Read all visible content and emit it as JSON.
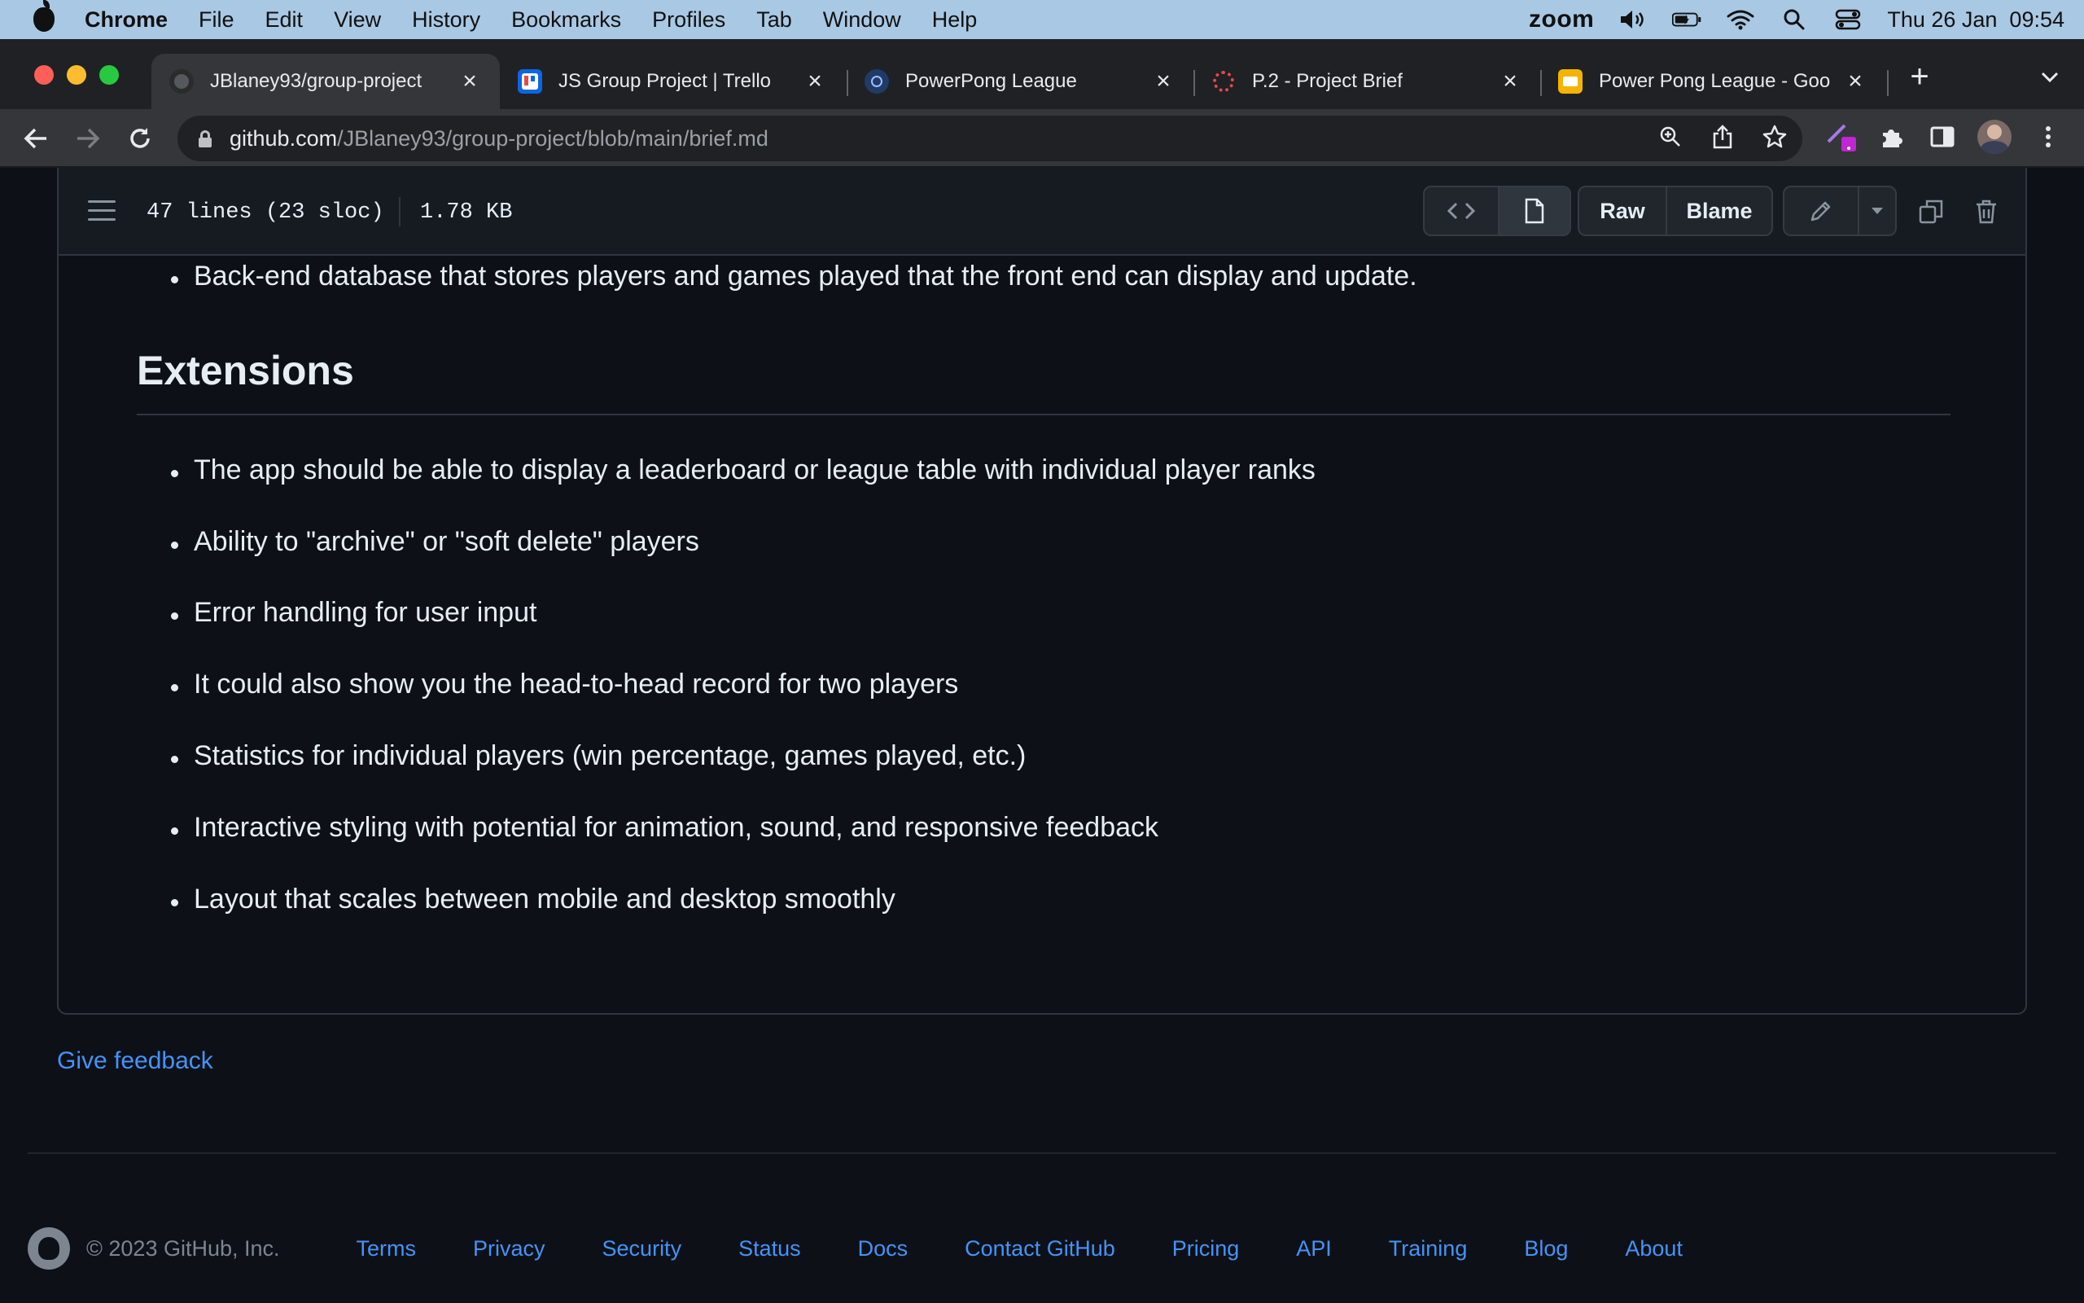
{
  "menubar": {
    "app": "Chrome",
    "items": [
      "File",
      "Edit",
      "View",
      "History",
      "Bookmarks",
      "Profiles",
      "Tab",
      "Window",
      "Help"
    ],
    "zoom_label": "zoom",
    "clock": "Thu 26 Jan  09:54"
  },
  "tabs": [
    {
      "title": "JBlaney93/group-project",
      "favicon": "github-icon",
      "active": true
    },
    {
      "title": "JS Group Project | Trello",
      "favicon": "trello-icon",
      "active": false
    },
    {
      "title": "PowerPong League",
      "favicon": "app-icon",
      "active": false
    },
    {
      "title": "P.2 - Project Brief",
      "favicon": "codeclan-icon",
      "active": false
    },
    {
      "title": "Power Pong League - Goo",
      "favicon": "slides-icon",
      "active": false
    }
  ],
  "omnibox": {
    "host": "github.com",
    "path": "/JBlaney93/group-project/blob/main/brief.md"
  },
  "file_header": {
    "lines": "47 lines (23 sloc)",
    "size": "1.78 KB",
    "raw_label": "Raw",
    "blame_label": "Blame"
  },
  "markdown": {
    "top_item": "Back-end database that stores players and games played that the front end can display and update.",
    "heading": "Extensions",
    "items": [
      "The app should be able to display a leaderboard or league table with individual player ranks",
      "Ability to \"archive\" or \"soft delete\" players",
      "Error handling for user input",
      "It could also show you the head-to-head record for two players",
      "Statistics for individual players (win percentage, games played, etc.)",
      "Interactive styling with potential for animation, sound, and responsive feedback",
      "Layout that scales between mobile and desktop smoothly"
    ]
  },
  "feedback_label": "Give feedback",
  "footer": {
    "copyright": "© 2023 GitHub, Inc.",
    "links": [
      "Terms",
      "Privacy",
      "Security",
      "Status",
      "Docs",
      "Contact GitHub",
      "Pricing",
      "API",
      "Training",
      "Blog",
      "About"
    ]
  },
  "colors": {
    "page_bg": "#0d1117",
    "link": "#4493f8",
    "menubar_bg": "#a9c8e4"
  }
}
